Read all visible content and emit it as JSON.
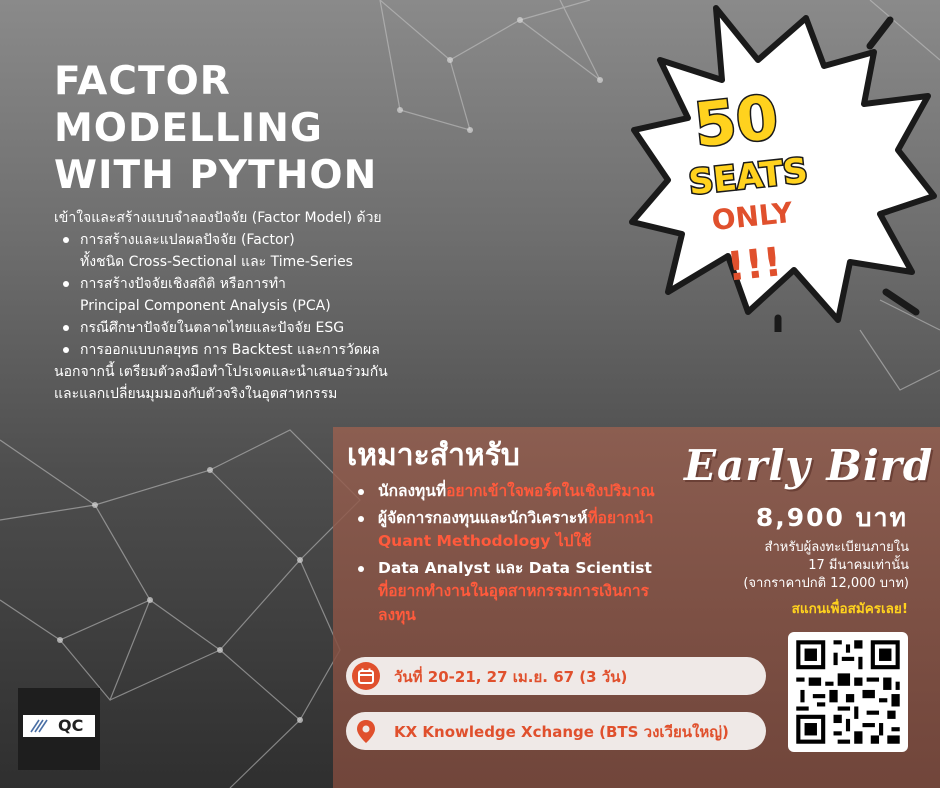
{
  "title": {
    "line1": "FACTOR",
    "line2": "MODELLING",
    "line3": "WITH PYTHON"
  },
  "intro": {
    "lead": "เข้าใจและสร้างแบบจำลองปัจจัย (Factor Model) ด้วย",
    "bullets": [
      {
        "l1": "การสร้างและแปลผลปัจจัย (Factor)",
        "l2": "ทั้งชนิด Cross-Sectional และ Time-Series"
      },
      {
        "l1": "การสร้างปัจจัยเชิงสถิติ หรือการทำ",
        "l2": "Principal Component Analysis (PCA)"
      },
      {
        "l1": "กรณีศึกษาปัจจัยในตลาดไทยและปัจจัย ESG"
      },
      {
        "l1": "การออกแบบกลยุทธ การ Backtest และการวัดผล"
      }
    ],
    "outro1": "นอกจากนี้ เตรียมตัวลงมือทำโปรเจคและนำเสนอร่วมกัน",
    "outro2": "และแลกเปลี่ยนมุมมองกับตัวจริงในอุตสาหกรรม"
  },
  "badge": {
    "number": "50",
    "seats": "SEATS",
    "only": "ONLY",
    "marks": "!!!"
  },
  "audience": {
    "heading": "เหมาะสำหรับ",
    "items": [
      {
        "white": "นักลงทุนที่",
        "red": "อยากเข้าใจพอร์ตในเชิงปริมาณ"
      },
      {
        "white": "ผู้จัดการกองทุนและนักวิเคราะห์",
        "red": "ที่อยากนำ Quant Methodology ไปใช้"
      },
      {
        "white": "Data Analyst และ Data Scientist",
        "red": "ที่อยากทำงานในอุตสาหกรรมการเงินการลงทุน"
      }
    ]
  },
  "offer": {
    "label": "Early Bird",
    "price": "8,900 บาท",
    "note1": "สำหรับผู้ลงทะเบียนภายใน",
    "note2": "17 มีนาคมเท่านั้น",
    "note3": "(จากราคาปกติ 12,000 บาท)",
    "cta": "สแกนเพื่อสมัครเลย!"
  },
  "event": {
    "date": "วันที่ 20-21, 27 เม.ย. 67 (3 วัน)",
    "location": "KX Knowledge Xchange (BTS วงเวียนใหญ่)"
  },
  "logo": {
    "text": "QC"
  },
  "icons": {
    "date": "calendar-icon",
    "location": "map-pin-icon",
    "qr": "qr-code"
  },
  "colors": {
    "accent": "#ff5a3c",
    "badge_yellow": "#ffd21e",
    "badge_orange": "#e0502d",
    "panel_brown": "#98604f"
  }
}
